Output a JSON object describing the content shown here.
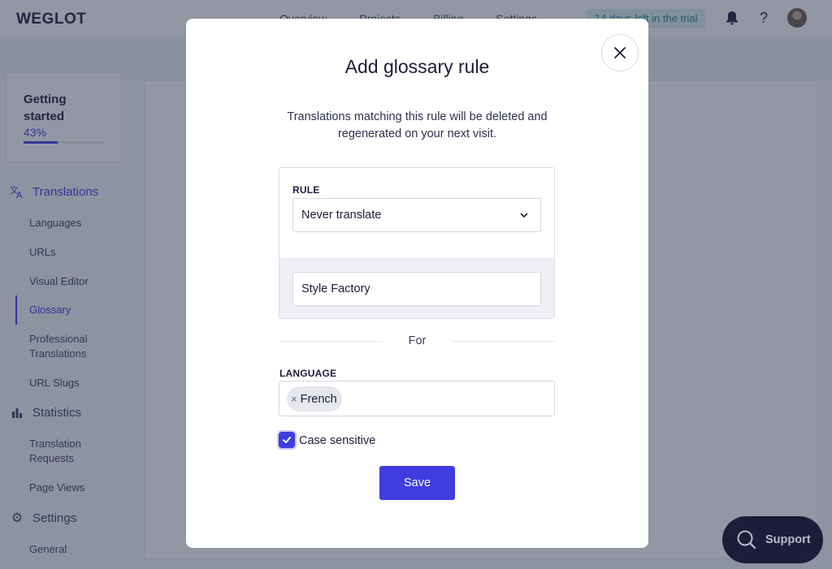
{
  "app": {
    "logo": "WEGLOT",
    "nav": [
      "Overview",
      "Projects",
      "Billing",
      "Settings"
    ],
    "trial_badge": "14 days left in the trial",
    "icons": {
      "notifications": "bell-icon",
      "help": "question-icon"
    }
  },
  "sidebar": {
    "getting_started": {
      "title": "Getting started",
      "percent_label": "43%",
      "progress": 0.43
    },
    "sections": [
      {
        "label": "Translations",
        "icon": "translate-icon",
        "items": [
          "Languages",
          "URLs",
          "Visual Editor",
          "Glossary",
          "Professional Translations",
          "URL Slugs"
        ]
      },
      {
        "label": "Statistics",
        "icon": "bar-chart-icon",
        "items": [
          "Translation Requests",
          "Page Views"
        ]
      },
      {
        "label": "Settings",
        "icon": "gear-icon",
        "items": [
          "General"
        ]
      }
    ],
    "active_item": "Glossary"
  },
  "modal": {
    "title": "Add glossary rule",
    "description": "Translations matching this rule will be deleted and regenerated on your next visit.",
    "rule_label": "RULE",
    "rule_value": "Never translate",
    "term_value": "Style Factory",
    "for_text": "For",
    "language_label": "LANGUAGE",
    "languages": [
      "French"
    ],
    "chip_remove": "×",
    "case_sensitive_label": "Case sensitive",
    "case_sensitive_checked": true,
    "save_label": "Save"
  },
  "support": {
    "label": "Support"
  },
  "colors": {
    "accent": "#3f3ce0",
    "dark": "#1c1d3a"
  }
}
